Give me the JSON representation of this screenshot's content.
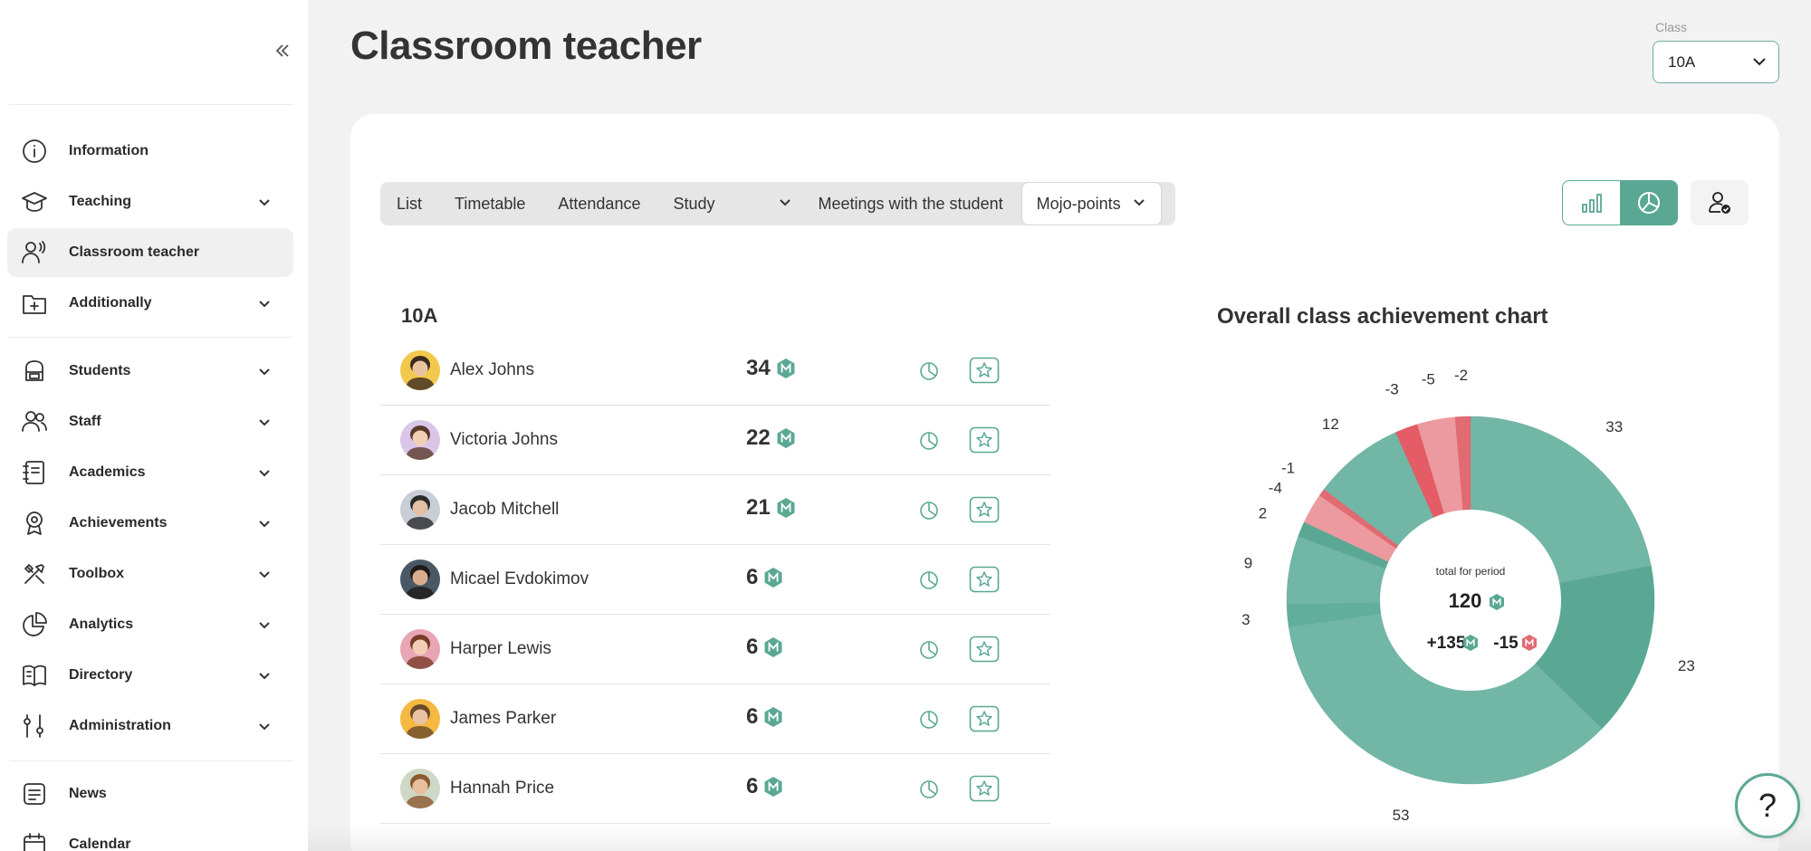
{
  "sidebar": {
    "items": [
      {
        "label": "Information",
        "icon": "info-icon",
        "chevron": false,
        "active": false
      },
      {
        "label": "Teaching",
        "icon": "graduation-cap-icon",
        "chevron": true,
        "active": false
      },
      {
        "label": "Classroom teacher",
        "icon": "teacher-icon",
        "chevron": false,
        "active": true
      },
      {
        "label": "Additionally",
        "icon": "folder-plus-icon",
        "chevron": true,
        "active": false
      },
      {
        "label": "Students",
        "icon": "backpack-icon",
        "chevron": true,
        "active": false
      },
      {
        "label": "Staff",
        "icon": "people-icon",
        "chevron": true,
        "active": false
      },
      {
        "label": "Academics",
        "icon": "notebook-icon",
        "chevron": true,
        "active": false
      },
      {
        "label": "Achievements",
        "icon": "medal-icon",
        "chevron": true,
        "active": false
      },
      {
        "label": "Toolbox",
        "icon": "tools-icon",
        "chevron": true,
        "active": false
      },
      {
        "label": "Analytics",
        "icon": "pie-chart-icon",
        "chevron": true,
        "active": false
      },
      {
        "label": "Directory",
        "icon": "book-icon",
        "chevron": true,
        "active": false
      },
      {
        "label": "Administration",
        "icon": "sliders-icon",
        "chevron": true,
        "active": false
      },
      {
        "label": "News",
        "icon": "news-icon",
        "chevron": false,
        "active": false
      },
      {
        "label": "Calendar",
        "icon": "calendar-icon",
        "chevron": false,
        "active": false
      }
    ]
  },
  "header": {
    "title": "Classroom teacher",
    "class_label": "Class",
    "class_value": "10A"
  },
  "tabs": [
    {
      "label": "List"
    },
    {
      "label": "Timetable"
    },
    {
      "label": "Attendance"
    },
    {
      "label": "Study"
    },
    {
      "label": "Meetings with the student"
    },
    {
      "label": "Mojo-points"
    }
  ],
  "list": {
    "title": "10A",
    "students": [
      {
        "name": "Alex Johns",
        "points": "34",
        "avatar_color": "#f2c94c",
        "hair_color": "#3b2a1e",
        "skin": "#e9c3a0"
      },
      {
        "name": "Victoria Johns",
        "points": "22",
        "avatar_color": "#d9c6e8",
        "hair_color": "#5a3a2a",
        "skin": "#f1cfb6"
      },
      {
        "name": "Jacob Mitchell",
        "points": "21",
        "avatar_color": "#c9ced6",
        "hair_color": "#2b2b2b",
        "skin": "#e3bfa3"
      },
      {
        "name": "Micael Evdokimov",
        "points": "6",
        "avatar_color": "#4a5866",
        "hair_color": "#1f1a17",
        "skin": "#d8ae8f"
      },
      {
        "name": "Harper Lewis",
        "points": "6",
        "avatar_color": "#e8a5b4",
        "hair_color": "#7a3b2a",
        "skin": "#f3cdb5"
      },
      {
        "name": "James Parker",
        "points": "6",
        "avatar_color": "#f5b942",
        "hair_color": "#6a4a2a",
        "skin": "#eac3a2"
      },
      {
        "name": "Hannah Price",
        "points": "6",
        "avatar_color": "#cfd8c6",
        "hair_color": "#8a5a2e",
        "skin": "#e8bf9e"
      }
    ]
  },
  "chart_data": {
    "type": "pie",
    "title": "Overall class achievement chart",
    "center_label": "total for period",
    "center_total": "120",
    "center_positive": "+135",
    "center_negative": "-15",
    "slices": [
      {
        "value": 33,
        "color": "#72b6a6"
      },
      {
        "value": 23,
        "color": "#5aa894"
      },
      {
        "value": 53,
        "color": "#72b6a6"
      },
      {
        "value": 3,
        "color": "#62ae9c"
      },
      {
        "value": 9,
        "color": "#72b6a6"
      },
      {
        "value": 2,
        "color": "#5aa894"
      },
      {
        "value": -4,
        "color": "#ec9a9f"
      },
      {
        "value": -1,
        "color": "#e06b73"
      },
      {
        "value": 12,
        "color": "#72b6a6"
      },
      {
        "value": -3,
        "color": "#e45c65"
      },
      {
        "value": -5,
        "color": "#ec9a9f"
      },
      {
        "value": -2,
        "color": "#e06b73"
      }
    ]
  },
  "colors": {
    "accent": "#5aa894",
    "positive": "#72b6a6",
    "negative": "#e06b73"
  },
  "help_label": "?"
}
